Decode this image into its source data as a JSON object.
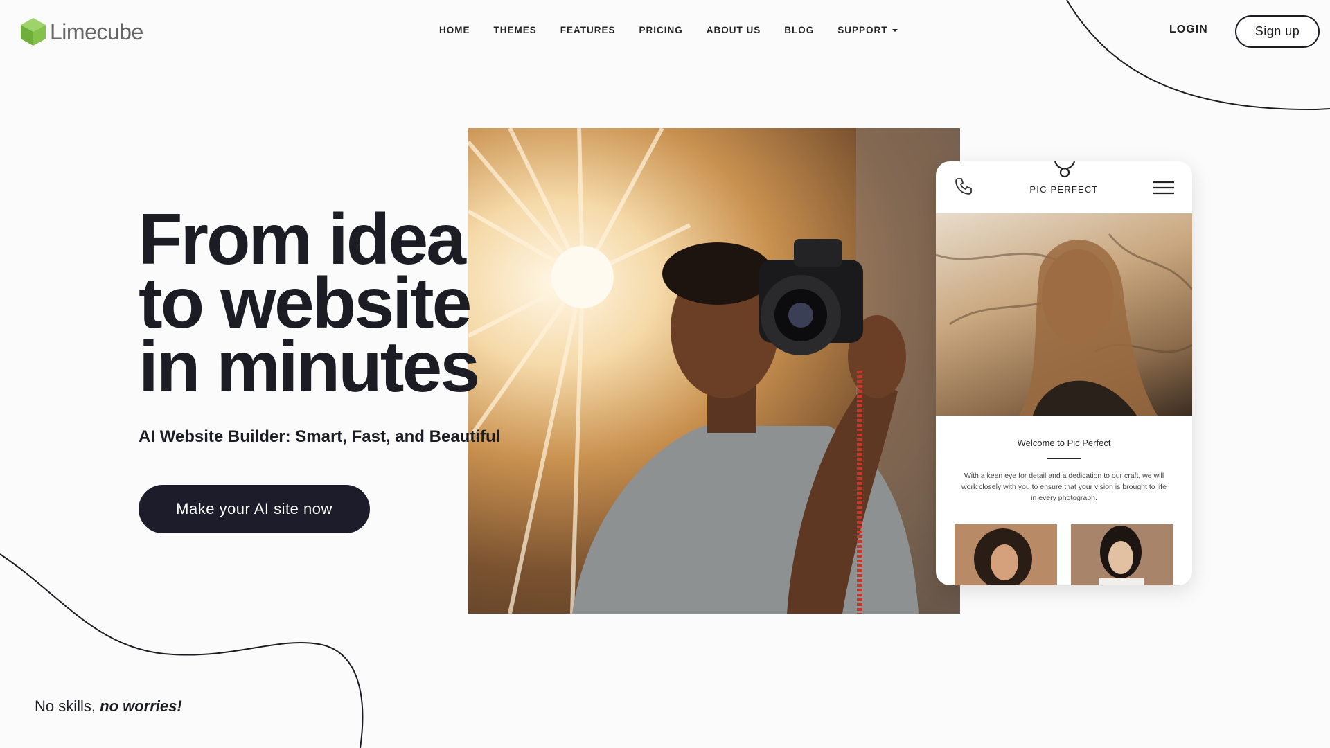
{
  "brand": {
    "name": "Limecube",
    "icon": "lime-cube-logo-icon",
    "accent": "#7ac143"
  },
  "nav": {
    "items": [
      {
        "label": "HOME"
      },
      {
        "label": "THEMES"
      },
      {
        "label": "FEATURES"
      },
      {
        "label": "PRICING"
      },
      {
        "label": "ABOUT US"
      },
      {
        "label": "BLOG"
      },
      {
        "label": "SUPPORT",
        "dropdown": true
      }
    ]
  },
  "auth": {
    "login": "LOGIN",
    "signup": "Sign up"
  },
  "hero": {
    "title_lines": [
      "From idea",
      "to website",
      "in minutes"
    ],
    "subtitle": "AI Website Builder: Smart, Fast, and Beautiful",
    "cta": "Make your AI site now"
  },
  "tagline": {
    "plain": "No skills,",
    "emphasis": "no worries!"
  },
  "phone_preview": {
    "brand": "PIC PERFECT",
    "icons": [
      "phone-icon",
      "hamburger-menu-icon"
    ],
    "welcome": "Welcome to Pic Perfect",
    "paragraph": "With a keen eye for detail and a dedication to our craft, we will work closely with you to ensure that your vision is brought to life in every photograph."
  },
  "colors": {
    "dark": "#1c1c24",
    "background": "#fbfbfb"
  }
}
